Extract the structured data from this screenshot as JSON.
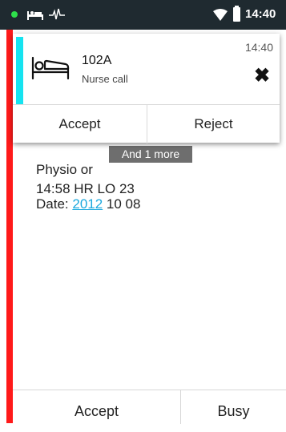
{
  "status_bar": {
    "time": "14:40",
    "icons": [
      "green-dot-icon",
      "bed-icon",
      "ecg-icon",
      "wifi-icon",
      "battery-icon"
    ]
  },
  "colors": {
    "status_bar_bg": "#1f2a30",
    "alarm_red": "#ff1a1a",
    "accent_cyan": "#15e3f0",
    "link_blue": "#1aa8de"
  },
  "notification": {
    "time": "14:40",
    "title": "102A",
    "subtitle": "Nurse call",
    "icon": "bed-icon",
    "close_icon": "close-icon",
    "accept_label": "Accept",
    "reject_label": "Reject"
  },
  "tooltip": {
    "text": "And 1 more"
  },
  "detail": {
    "line1": "Physio or",
    "line2": "14:58 HR LO 23",
    "date_label": "Date: ",
    "date_year": "2012",
    "date_rest": " 10 08"
  },
  "bottom_actions": {
    "accept_label": "Accept",
    "busy_label": "Busy"
  }
}
